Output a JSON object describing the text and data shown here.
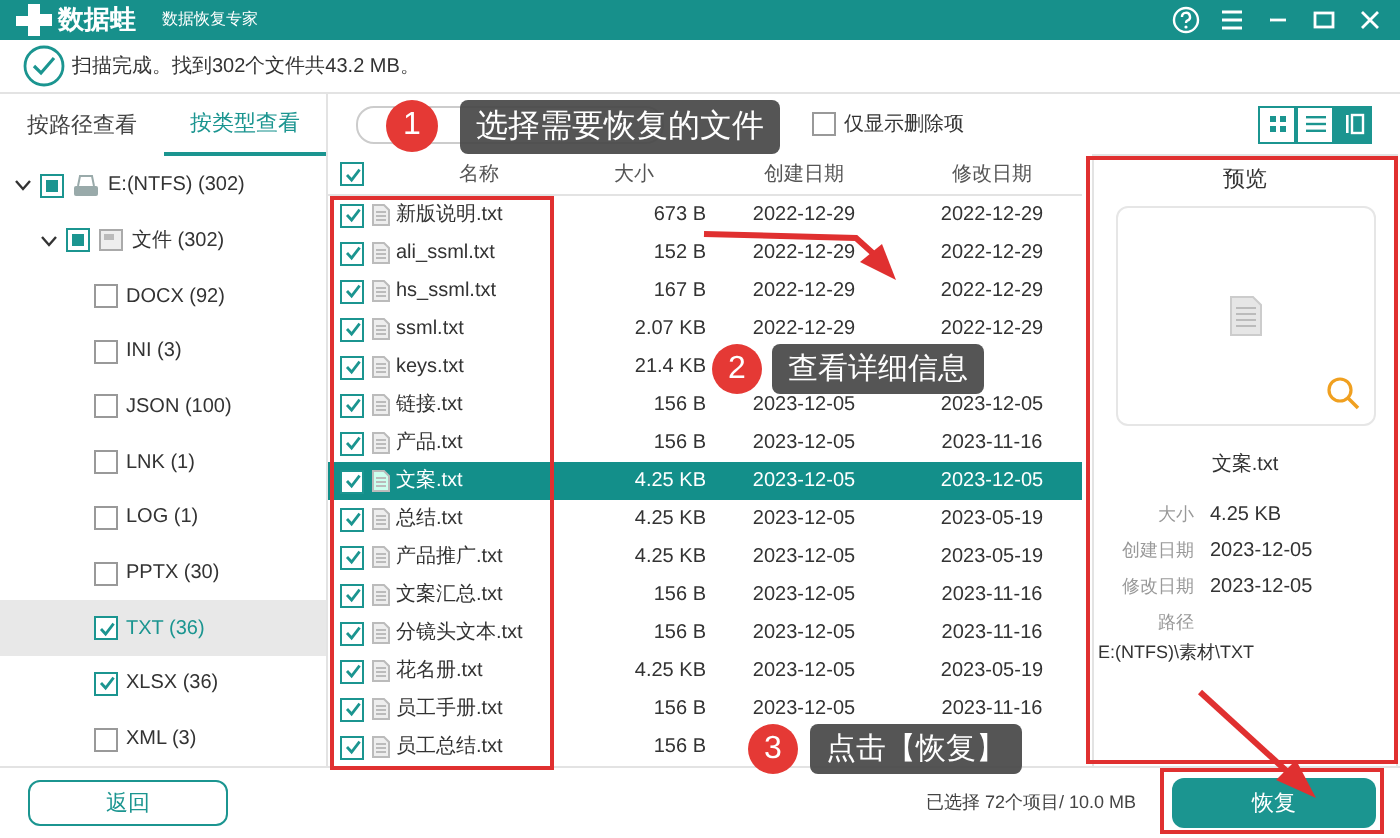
{
  "window": {
    "logo": "数据蛙",
    "subtitle": "数据恢复专家"
  },
  "scan_status": "扫描完成。找到302个文件共43.2 MB。",
  "tabs": [
    {
      "label": "按路径查看",
      "selected": false
    },
    {
      "label": "按类型查看",
      "selected": true
    }
  ],
  "tree": [
    {
      "kind": "drive",
      "label": "E:(NTFS) (302)",
      "expanded": true,
      "checked": true,
      "partial": true,
      "selected": false,
      "children": [
        {
          "kind": "folder",
          "label": "文件 (302)",
          "expanded": true,
          "checked": true,
          "partial": true,
          "selected": false,
          "children": [
            {
              "label": "DOCX (92)",
              "checked": false,
              "partial": false,
              "selected": false
            },
            {
              "label": "INI (3)",
              "checked": false,
              "partial": false,
              "selected": false
            },
            {
              "label": "JSON (100)",
              "checked": false,
              "partial": false,
              "selected": false
            },
            {
              "label": "LNK (1)",
              "checked": false,
              "partial": false,
              "selected": false
            },
            {
              "label": "LOG (1)",
              "checked": false,
              "partial": false,
              "selected": false
            },
            {
              "label": "PPTX (30)",
              "checked": false,
              "partial": false,
              "selected": false
            },
            {
              "label": "TXT (36)",
              "checked": true,
              "partial": false,
              "selected": true
            },
            {
              "label": "XLSX (36)",
              "checked": true,
              "partial": false,
              "selected": false
            },
            {
              "label": "XML (3)",
              "checked": false,
              "partial": false,
              "selected": false
            }
          ]
        }
      ]
    }
  ],
  "toolbar": {
    "deleted_only": {
      "label": "仅显示删除项",
      "checked": false
    },
    "views": [
      {
        "kind": "grid",
        "selected": false
      },
      {
        "kind": "list",
        "selected": false
      },
      {
        "kind": "panel",
        "selected": true
      }
    ]
  },
  "table": {
    "all_checked": true,
    "columns": [
      "名称",
      "大小",
      "创建日期",
      "修改日期"
    ],
    "rows": [
      {
        "name": "新版说明.txt",
        "size": "673 B",
        "created": "2022-12-29",
        "modified": "2022-12-29",
        "checked": true,
        "selected": false
      },
      {
        "name": "ali_ssml.txt",
        "size": "152 B",
        "created": "2022-12-29",
        "modified": "2022-12-29",
        "checked": true,
        "selected": false
      },
      {
        "name": "hs_ssml.txt",
        "size": "167 B",
        "created": "2022-12-29",
        "modified": "2022-12-29",
        "checked": true,
        "selected": false
      },
      {
        "name": "ssml.txt",
        "size": "2.07 KB",
        "created": "2022-12-29",
        "modified": "2022-12-29",
        "checked": true,
        "selected": false
      },
      {
        "name": "keys.txt",
        "size": "21.4 KB",
        "checked": true,
        "selected": false
      },
      {
        "name": "链接.txt",
        "size": "156 B",
        "created": "2023-12-05",
        "modified": "2023-12-05",
        "checked": true,
        "selected": false
      },
      {
        "name": "产品.txt",
        "size": "156 B",
        "created": "2023-12-05",
        "modified": "2023-11-16",
        "checked": true,
        "selected": false
      },
      {
        "name": "文案.txt",
        "size": "4.25 KB",
        "created": "2023-12-05",
        "modified": "2023-12-05",
        "checked": true,
        "selected": true
      },
      {
        "name": "总结.txt",
        "size": "4.25 KB",
        "created": "2023-12-05",
        "modified": "2023-05-19",
        "checked": true,
        "selected": false
      },
      {
        "name": "产品推广.txt",
        "size": "4.25 KB",
        "created": "2023-12-05",
        "modified": "2023-05-19",
        "checked": true,
        "selected": false
      },
      {
        "name": "文案汇总.txt",
        "size": "156 B",
        "created": "2023-12-05",
        "modified": "2023-11-16",
        "checked": true,
        "selected": false
      },
      {
        "name": "分镜头文本.txt",
        "size": "156 B",
        "created": "2023-12-05",
        "modified": "2023-11-16",
        "checked": true,
        "selected": false
      },
      {
        "name": "花名册.txt",
        "size": "4.25 KB",
        "created": "2023-12-05",
        "modified": "2023-05-19",
        "checked": true,
        "selected": false
      },
      {
        "name": "员工手册.txt",
        "size": "156 B",
        "created": "2023-12-05",
        "modified": "2023-11-16",
        "checked": true,
        "selected": false
      },
      {
        "name": "员工总结.txt",
        "size": "156 B",
        "checked": true,
        "selected": false
      }
    ]
  },
  "preview": {
    "title": "预览",
    "filename": "文案.txt",
    "info": [
      {
        "label": "大小",
        "value": "4.25 KB"
      },
      {
        "label": "创建日期",
        "value": "2023-12-05"
      },
      {
        "label": "修改日期",
        "value": "2023-12-05"
      },
      {
        "label": "路径"
      }
    ],
    "path": "E:(NTFS)\\素材\\TXT"
  },
  "footer": {
    "back_button": "返回",
    "selection": "已选择 72个项目/ 10.0 MB",
    "recover_button": "恢复"
  },
  "callouts": [
    {
      "number": "1",
      "text": "选择需要恢复的文件"
    },
    {
      "number": "2",
      "text": "查看详细信息"
    },
    {
      "number": "3",
      "text": "点击【恢复】"
    }
  ]
}
